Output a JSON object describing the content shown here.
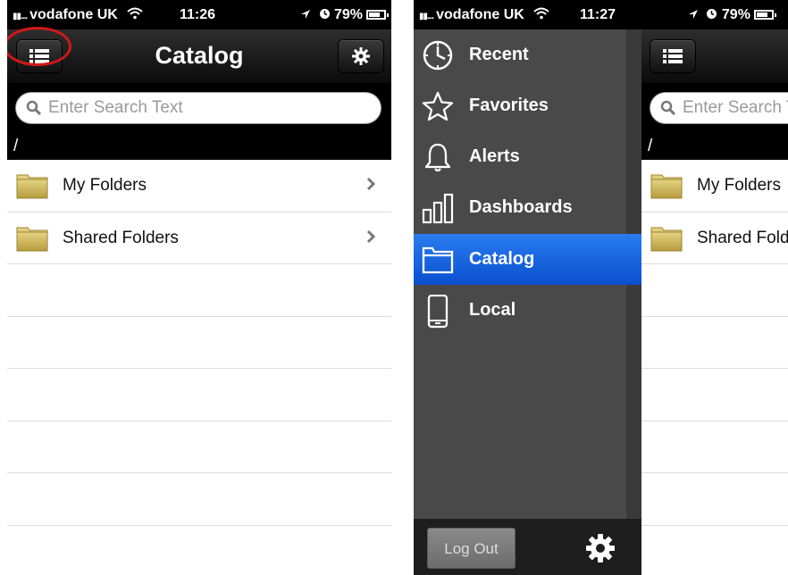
{
  "left_screen": {
    "status_bar": {
      "signal": "▮▮....",
      "carrier": "vodafone UK",
      "time": "11:26",
      "battery": "79%"
    },
    "nav": {
      "title": "Catalog",
      "menu_button": "list-icon",
      "settings_button": "gear-icon"
    },
    "search": {
      "placeholder": "Enter Search Text"
    },
    "path": "/",
    "items": [
      {
        "label": "My Folders",
        "icon": "folder-icon"
      },
      {
        "label": "Shared Folders",
        "icon": "folder-icon"
      }
    ]
  },
  "right_screen": {
    "status_bar": {
      "signal": "▮▮....",
      "carrier": "vodafone UK",
      "time": "11:27",
      "battery": "79%"
    },
    "menu": {
      "items": [
        {
          "label": "Recent",
          "icon": "clock-icon"
        },
        {
          "label": "Favorites",
          "icon": "star-icon"
        },
        {
          "label": "Alerts",
          "icon": "bell-icon"
        },
        {
          "label": "Dashboards",
          "icon": "bar-chart-icon"
        },
        {
          "label": "Catalog",
          "icon": "folder-icon",
          "active": true
        },
        {
          "label": "Local",
          "icon": "phone-icon"
        }
      ],
      "logout_label": "Log Out"
    },
    "search": {
      "placeholder": "Enter Search Text"
    },
    "path": "/",
    "items": [
      {
        "label": "My Folders"
      },
      {
        "label": "Shared Folders"
      }
    ]
  },
  "colors": {
    "accent": "#1a66e0",
    "highlight": "#d01818",
    "menu_bg": "#494949"
  }
}
